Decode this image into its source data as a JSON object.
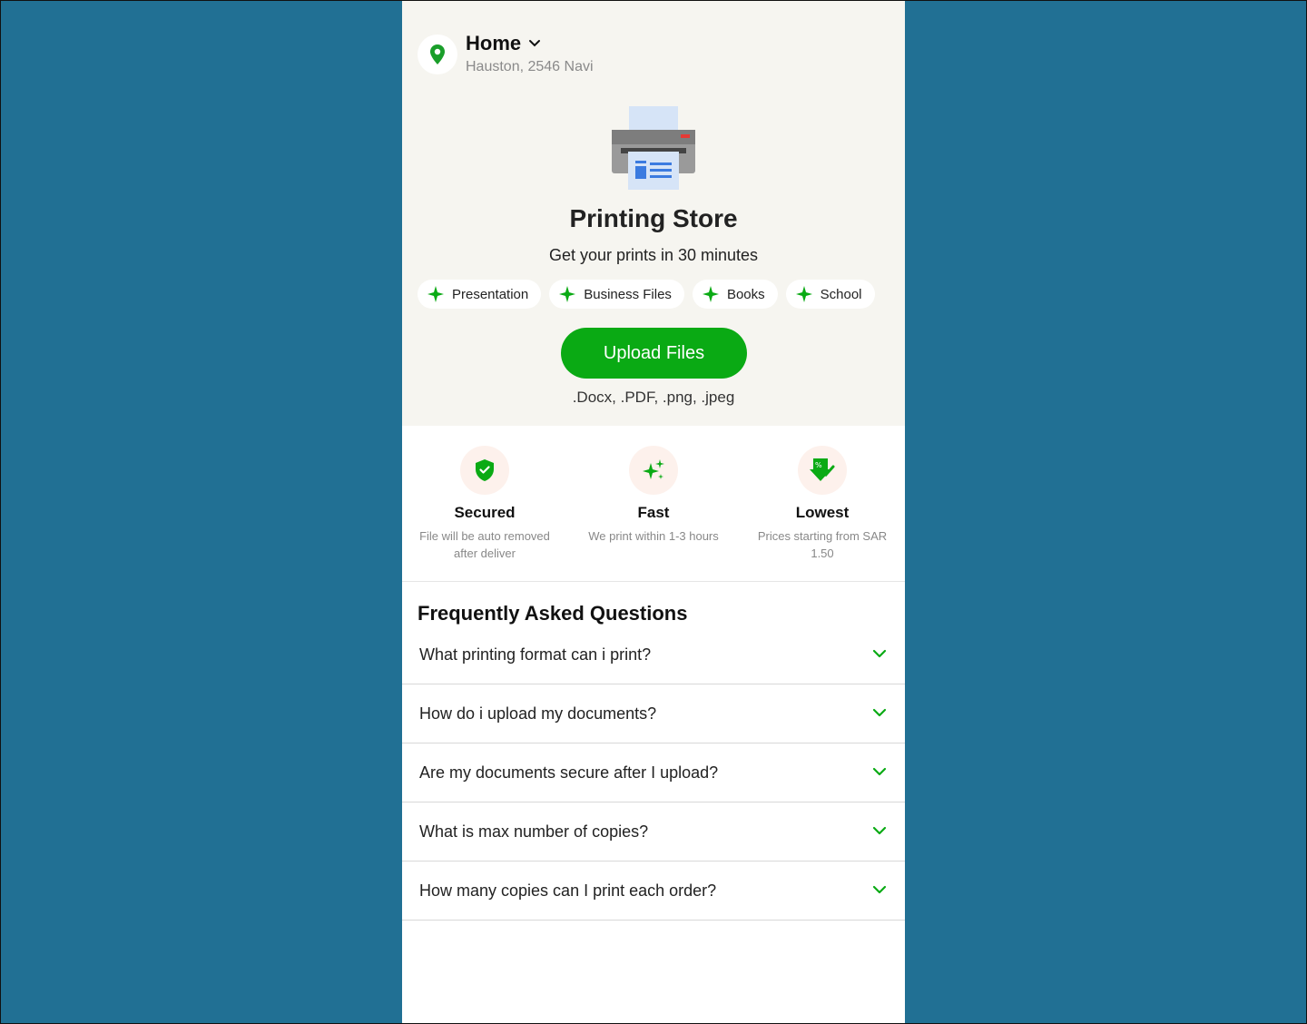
{
  "header": {
    "location_title": "Home",
    "location_address": "Hauston, 2546 Navi"
  },
  "hero": {
    "title": "Printing Store",
    "subtitle": "Get your prints in 30 minutes",
    "chips": [
      "Presentation",
      "Business Files",
      "Books",
      "School"
    ],
    "upload_label": "Upload Files",
    "formats": ".Docx, .PDF, .png, .jpeg"
  },
  "features": [
    {
      "icon": "shield-check-icon",
      "title": "Secured",
      "desc": "File will be auto removed after deliver"
    },
    {
      "icon": "sparkle-icon",
      "title": "Fast",
      "desc": "We print within 1-3 hours"
    },
    {
      "icon": "price-tag-icon",
      "title": "Lowest",
      "desc": "Prices starting from SAR 1.50"
    }
  ],
  "faq": {
    "title": "Frequently Asked Questions",
    "items": [
      "What printing format can i print?",
      "How do i upload my documents?",
      "Are my documents secure after I upload?",
      "What is max number of copies?",
      "How many copies can I print each order?"
    ]
  },
  "colors": {
    "background": "#217094",
    "accent_green": "#0aaa14",
    "hero_bg": "#f6f5f0",
    "feature_icon_bg": "#fdf1ec"
  }
}
